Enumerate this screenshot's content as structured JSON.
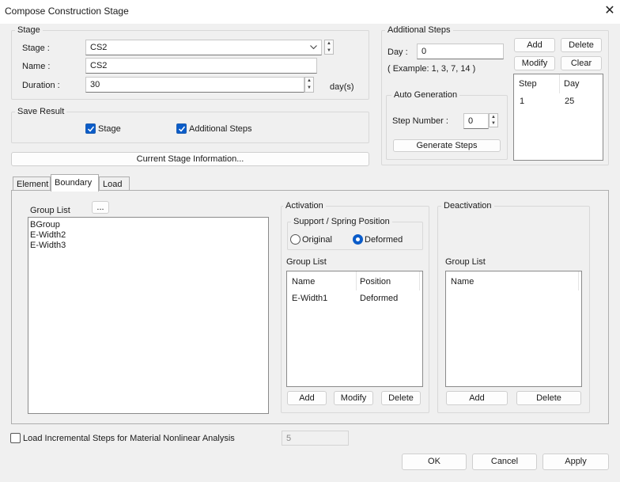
{
  "window": {
    "title": "Compose Construction Stage",
    "close_glyph": "✕"
  },
  "stage_group": {
    "label": "Stage",
    "stage_label": "Stage :",
    "stage_value": "CS2",
    "name_label": "Name :",
    "name_value": "CS2",
    "duration_label": "Duration :",
    "duration_value": "30",
    "duration_unit": "day(s)"
  },
  "save_result": {
    "label": "Save Result",
    "stage_checkbox": "Stage",
    "stage_checked": true,
    "additional_checkbox": "Additional Steps",
    "additional_checked": true
  },
  "current_stage_button": "Current Stage Information...",
  "additional_steps": {
    "label": "Additional Steps",
    "day_label": "Day :",
    "day_value": "0",
    "example_text": "( Example: 1, 3, 7, 14 )",
    "add_button": "Add",
    "delete_button": "Delete",
    "modify_button": "Modify",
    "clear_button": "Clear",
    "table_headers": [
      "Step",
      "Day"
    ],
    "rows": [
      {
        "step": "1",
        "day": "25"
      }
    ],
    "auto_generation": {
      "label": "Auto Generation",
      "step_number_label": "Step Number :",
      "step_number_value": "0",
      "generate_button": "Generate Steps"
    }
  },
  "tabs": [
    "Element",
    "Boundary",
    "Load"
  ],
  "active_tab": "Boundary",
  "boundary": {
    "group_list_label": "Group List",
    "browse_button": "...",
    "group_items": [
      "BGroup",
      "E-Width2",
      "E-Width3"
    ],
    "activation": {
      "label": "Activation",
      "support_label": "Support / Spring Position",
      "original_label": "Original",
      "deformed_label": "Deformed",
      "selected": "Deformed",
      "group_list_label": "Group List",
      "headers": [
        "Name",
        "Position"
      ],
      "rows": [
        {
          "name": "E-Width1",
          "position": "Deformed"
        }
      ],
      "add_button": "Add",
      "modify_button": "Modify",
      "delete_button": "Delete"
    },
    "deactivation": {
      "label": "Deactivation",
      "group_list_label": "Group List",
      "headers": [
        "Name"
      ],
      "add_button": "Add",
      "delete_button": "Delete"
    }
  },
  "load_incremental": {
    "label": "Load Incremental Steps for Material Nonlinear Analysis",
    "checked": false,
    "value": "5"
  },
  "footer": {
    "ok": "OK",
    "cancel": "Cancel",
    "apply": "Apply"
  },
  "colors": {
    "accent": "#0b5cc9",
    "window_bg": "#f0f0f0"
  },
  "icons": [
    "close-icon",
    "chevron-down-icon",
    "spin-up-icon",
    "spin-down-icon",
    "checkmark-icon"
  ]
}
